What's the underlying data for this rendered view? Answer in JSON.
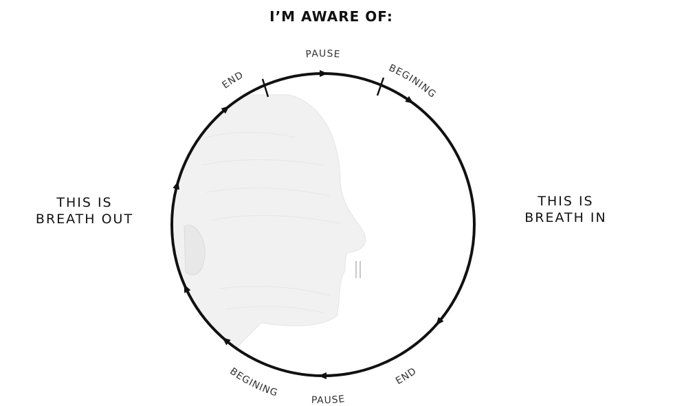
{
  "heading": "I’M AWARE OF:",
  "left_label": {
    "line1": "THIS IS",
    "line2": "BREATH OUT"
  },
  "right_label": {
    "line1": "THIS IS",
    "line2": "BREATH IN"
  },
  "phase_labels": {
    "top_end": "END",
    "top_pause": "PAUSE",
    "top_begining": "BEGINING",
    "bottom_begining": "BEGINING",
    "bottom_pause": "PAUSE",
    "bottom_end": "END"
  },
  "colors": {
    "stroke": "#111111",
    "text": "#333333",
    "face": "#d9d9d9"
  },
  "icons": [
    "face-profile-sketch-icon",
    "direction-arrow-icon",
    "breath-updown-arrows-icon"
  ]
}
